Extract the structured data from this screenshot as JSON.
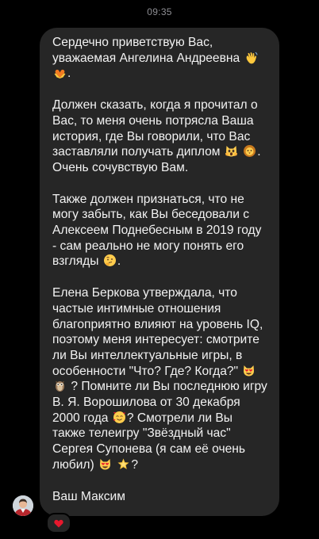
{
  "status_time": "09:35",
  "message": {
    "lines": [
      [
        "Сердечно приветствую Вас,",
        "уважаемая Ангелина Андреевна",
        ""
      ],
      [
        "Должен сказать, когда я прочитал о",
        "Вас, то меня очень потрясла Ваша",
        "история, где Вы говорили, что Вас",
        "заставляли получать диплом",
        "Очень сочувствую Вам."
      ],
      [
        "Также должен признаться, что не",
        "могу забыть, как Вы беседовали с",
        "Алексеем Поднебесным в 2019 году",
        "- сам реально не могу понять его",
        "взгляды"
      ],
      [
        "Елена Беркова утверждала, что",
        "частые интимные отношения",
        "благоприятно влияют на уровень IQ,",
        "поэтому меня интересует: смотрите",
        "ли Вы интеллектуальные игры, в",
        "особенности \"Что? Где? Когда?\"",
        "? Помните ли Вы последнюю игру",
        "В. Я. Ворошилова от 30 декабря",
        "2000 года",
        "? Смотрели ли Вы",
        "также телеигру \"Звёздный час\"",
        "Сергея Супонева (я сам её очень",
        "любил)",
        "?"
      ],
      [
        "Ваш Максим"
      ]
    ],
    "trailing_dot": ".",
    "emojis": {
      "wave": "waving-hand-emoji",
      "heart_hands": "heart-hands-emoji",
      "scream_cat": "weary-cat-emoji",
      "lion": "lion-emoji",
      "thinking": "thinking-face-emoji",
      "heart_eyes_cat": "heart-eyes-cat-emoji",
      "owl": "owl-emoji",
      "smiling_hearts": "smiling-face-with-hearts-emoji",
      "star": "glowing-star-emoji"
    }
  },
  "reaction": "heart-reaction",
  "colors": {
    "background": "#000000",
    "bubble": "#262626",
    "text": "#f2f2f2",
    "timestamp": "#8e8e93",
    "reaction_heart": "#e8182d"
  }
}
